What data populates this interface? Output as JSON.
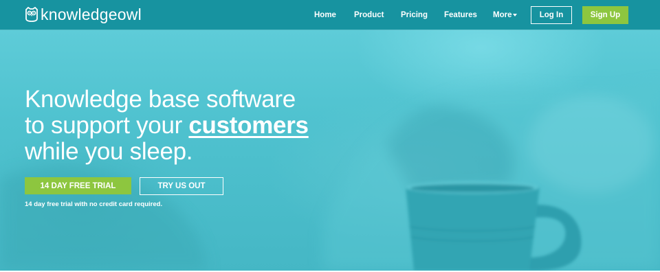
{
  "brand": {
    "logo_text": "knowledgeowl",
    "logo_icon": "owl-icon"
  },
  "nav": {
    "home": "Home",
    "product": "Product",
    "pricing": "Pricing",
    "features": "Features",
    "more": "More",
    "login": "Log In",
    "signup": "Sign Up"
  },
  "hero": {
    "line1": "Knowledge base software",
    "line2_prefix": "to support your ",
    "line2_emphasis": "customers",
    "line3": "while you sleep.",
    "primary_cta": "14 DAY FREE TRIAL",
    "secondary_cta": "TRY US OUT",
    "note": "14 day free trial with no credit card required."
  },
  "colors": {
    "nav_bg": "#1793a0",
    "hero_bg": "#4fc2cf",
    "accent_green": "#8dc63f",
    "text": "#ffffff"
  }
}
